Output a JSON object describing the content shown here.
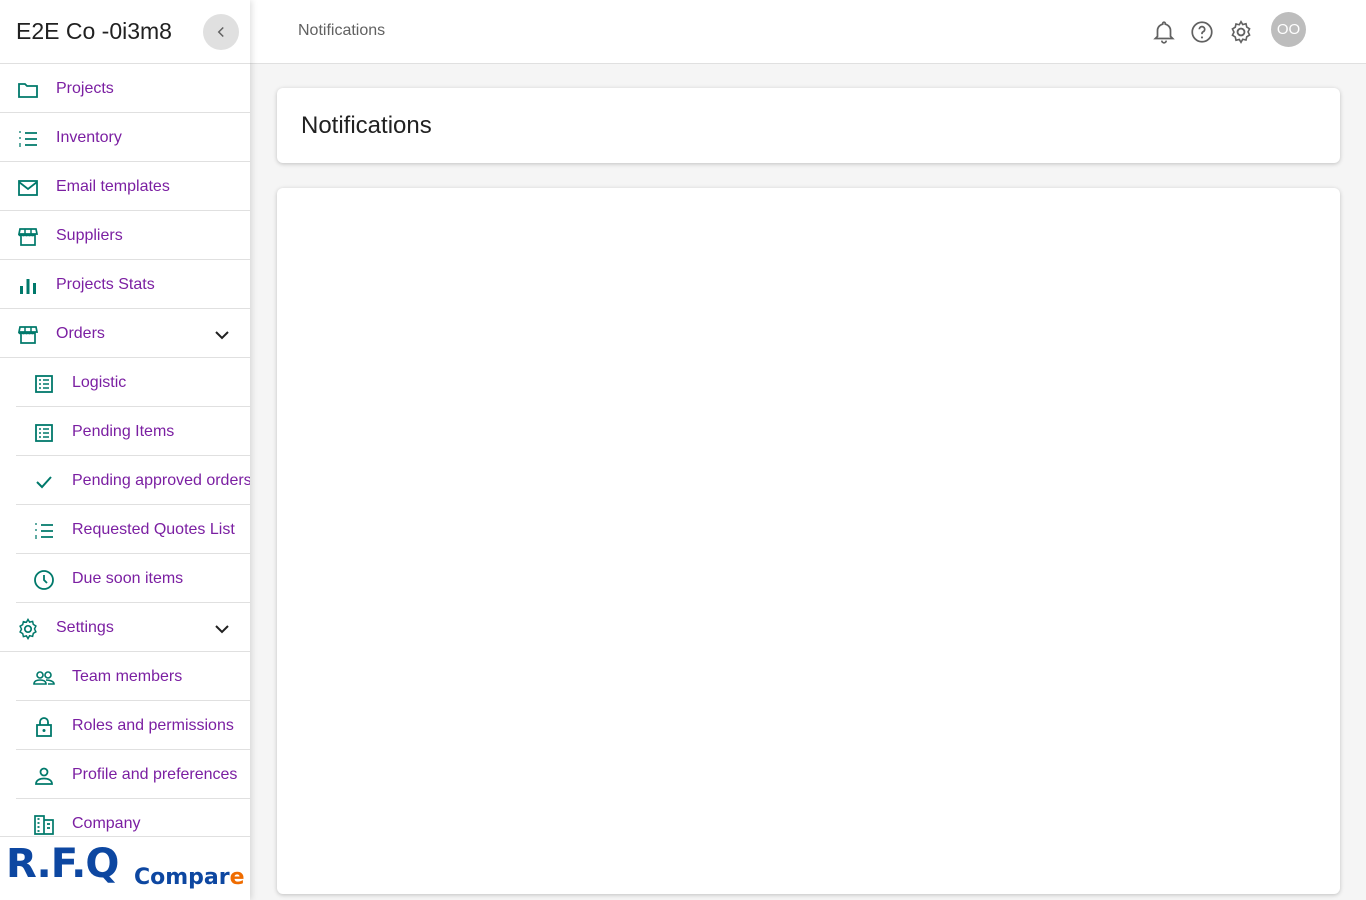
{
  "sidebar": {
    "company_name": "E2E Co -0i3m8",
    "collapse_icon": "chevron-left-icon",
    "items": [
      {
        "label": "Projects",
        "icon": "folder-icon"
      },
      {
        "label": "Inventory",
        "icon": "list-numbered-icon"
      },
      {
        "label": "Email templates",
        "icon": "mail-icon"
      },
      {
        "label": "Suppliers",
        "icon": "store-icon"
      },
      {
        "label": "Projects Stats",
        "icon": "bar-chart-icon"
      },
      {
        "label": "Orders",
        "icon": "store-icon",
        "expanded": true
      },
      {
        "label": "Logistic",
        "icon": "list-alt-icon"
      },
      {
        "label": "Pending Items",
        "icon": "list-alt-icon"
      },
      {
        "label": "Pending approved orders",
        "icon": "check-icon"
      },
      {
        "label": "Requested Quotes List",
        "icon": "list-numbered-icon"
      },
      {
        "label": "Due soon items",
        "icon": "clock-icon"
      },
      {
        "label": "Settings",
        "icon": "gear-icon",
        "expanded": true
      },
      {
        "label": "Team members",
        "icon": "people-icon"
      },
      {
        "label": "Roles and permissions",
        "icon": "lock-icon"
      },
      {
        "label": "Profile and preferences",
        "icon": "person-icon"
      },
      {
        "label": "Company",
        "icon": "building-icon"
      }
    ],
    "logo": {
      "text_main": "R.F.Q",
      "text_sub": "Compare",
      "color_main": "#0d47a1",
      "color_accent": "#ef6c00"
    }
  },
  "topbar": {
    "breadcrumb": "Notifications",
    "avatar_initials": "OO",
    "icons": [
      "bell-icon",
      "help-icon",
      "gear-icon"
    ]
  },
  "main": {
    "title": "Notifications"
  },
  "colors": {
    "accent_text": "#7b1fa2",
    "icon_teal": "#00796b"
  }
}
